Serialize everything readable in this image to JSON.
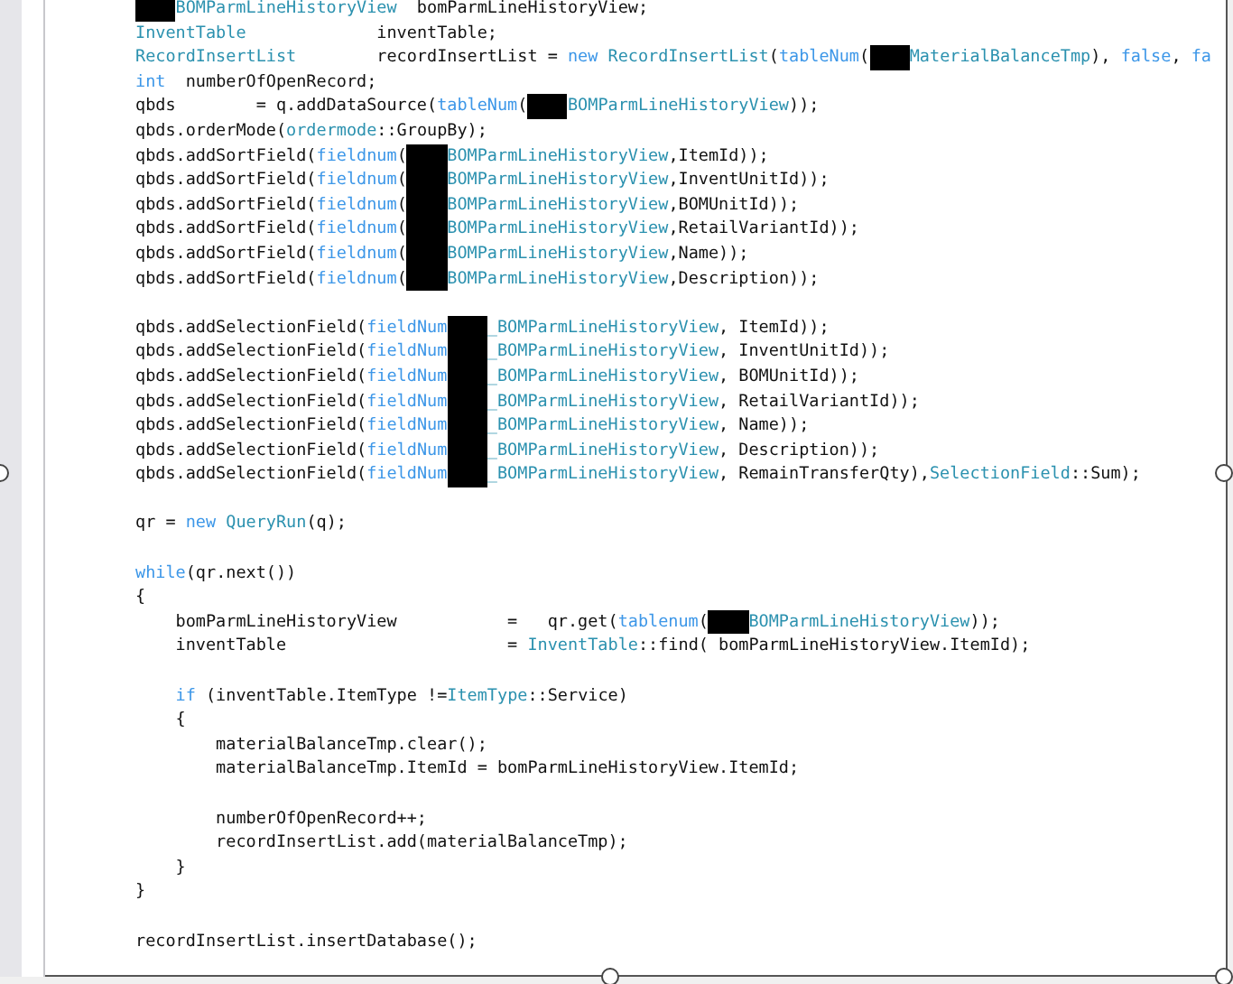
{
  "code_lines": [
    {
      "kind": "code",
      "tokens": [
        {
          "kind": "redacted"
        },
        {
          "kind": "type",
          "text": "BOMParmLineHistoryView"
        },
        {
          "kind": "plain",
          "text": "  bomParmLineHistoryView;"
        }
      ]
    },
    {
      "kind": "code",
      "tokens": [
        {
          "kind": "type",
          "text": "InventTable"
        },
        {
          "kind": "plain",
          "text": "             inventTable;"
        }
      ]
    },
    {
      "kind": "code",
      "tokens": [
        {
          "kind": "type",
          "text": "RecordInsertList"
        },
        {
          "kind": "plain",
          "text": "        recordInsertList = "
        },
        {
          "kind": "keyword",
          "text": "new "
        },
        {
          "kind": "type",
          "text": "RecordInsertList"
        },
        {
          "kind": "plain",
          "text": "("
        },
        {
          "kind": "keyword",
          "text": "tableNum"
        },
        {
          "kind": "plain",
          "text": "("
        },
        {
          "kind": "redacted"
        },
        {
          "kind": "type",
          "text": "MaterialBalanceTmp"
        },
        {
          "kind": "plain",
          "text": "), "
        },
        {
          "kind": "keyword",
          "text": "false"
        },
        {
          "kind": "plain",
          "text": ", "
        },
        {
          "kind": "keyword",
          "text": "fa"
        }
      ]
    },
    {
      "kind": "code",
      "tokens": [
        {
          "kind": "keyword",
          "text": "int"
        },
        {
          "kind": "plain",
          "text": "  numberOfOpenRecord;"
        }
      ]
    },
    {
      "kind": "code",
      "tokens": [
        {
          "kind": "plain",
          "text": "qbds        = q.addDataSource("
        },
        {
          "kind": "keyword",
          "text": "tableNum"
        },
        {
          "kind": "plain",
          "text": "("
        },
        {
          "kind": "redacted"
        },
        {
          "kind": "type",
          "text": "BOMParmLineHistoryView"
        },
        {
          "kind": "plain",
          "text": "));"
        }
      ]
    },
    {
      "kind": "code",
      "tokens": [
        {
          "kind": "plain",
          "text": "qbds.orderMode("
        },
        {
          "kind": "type",
          "text": "ordermode"
        },
        {
          "kind": "plain",
          "text": "::GroupBy);"
        }
      ]
    },
    {
      "kind": "code",
      "tokens": [
        {
          "kind": "plain",
          "text": "qbds.addSortField("
        },
        {
          "kind": "keyword",
          "text": "fieldnum"
        },
        {
          "kind": "plain",
          "text": "("
        },
        {
          "kind": "redacted"
        },
        {
          "kind": "type",
          "text": "BOMParmLineHistoryView"
        },
        {
          "kind": "plain",
          "text": ",ItemId));"
        }
      ]
    },
    {
      "kind": "code",
      "tokens": [
        {
          "kind": "plain",
          "text": "qbds.addSortField("
        },
        {
          "kind": "keyword",
          "text": "fieldnum"
        },
        {
          "kind": "plain",
          "text": "("
        },
        {
          "kind": "redacted"
        },
        {
          "kind": "type",
          "text": "BOMParmLineHistoryView"
        },
        {
          "kind": "plain",
          "text": ",InventUnitId));"
        }
      ]
    },
    {
      "kind": "code",
      "tokens": [
        {
          "kind": "plain",
          "text": "qbds.addSortField("
        },
        {
          "kind": "keyword",
          "text": "fieldnum"
        },
        {
          "kind": "plain",
          "text": "("
        },
        {
          "kind": "redacted"
        },
        {
          "kind": "type",
          "text": "BOMParmLineHistoryView"
        },
        {
          "kind": "plain",
          "text": ",BOMUnitId));"
        }
      ]
    },
    {
      "kind": "code",
      "tokens": [
        {
          "kind": "plain",
          "text": "qbds.addSortField("
        },
        {
          "kind": "keyword",
          "text": "fieldnum"
        },
        {
          "kind": "plain",
          "text": "("
        },
        {
          "kind": "redacted"
        },
        {
          "kind": "type",
          "text": "BOMParmLineHistoryView"
        },
        {
          "kind": "plain",
          "text": ",RetailVariantId));"
        }
      ]
    },
    {
      "kind": "code",
      "tokens": [
        {
          "kind": "plain",
          "text": "qbds.addSortField("
        },
        {
          "kind": "keyword",
          "text": "fieldnum"
        },
        {
          "kind": "plain",
          "text": "("
        },
        {
          "kind": "redacted"
        },
        {
          "kind": "type",
          "text": "BOMParmLineHistoryView"
        },
        {
          "kind": "plain",
          "text": ",Name));"
        }
      ]
    },
    {
      "kind": "code",
      "tokens": [
        {
          "kind": "plain",
          "text": "qbds.addSortField("
        },
        {
          "kind": "keyword",
          "text": "fieldnum"
        },
        {
          "kind": "plain",
          "text": "("
        },
        {
          "kind": "redacted"
        },
        {
          "kind": "type",
          "text": "BOMParmLineHistoryView"
        },
        {
          "kind": "plain",
          "text": ",Description));"
        }
      ]
    },
    {
      "kind": "blank"
    },
    {
      "kind": "code",
      "tokens": [
        {
          "kind": "plain",
          "text": "qbds.addSelectionField("
        },
        {
          "kind": "keyword",
          "text": "fieldNum"
        },
        {
          "kind": "redacted"
        },
        {
          "kind": "type",
          "text": "_BOMParmLineHistoryView"
        },
        {
          "kind": "plain",
          "text": ", ItemId));"
        }
      ]
    },
    {
      "kind": "code",
      "tokens": [
        {
          "kind": "plain",
          "text": "qbds.addSelectionField("
        },
        {
          "kind": "keyword",
          "text": "fieldNum"
        },
        {
          "kind": "redacted"
        },
        {
          "kind": "type",
          "text": "_BOMParmLineHistoryView"
        },
        {
          "kind": "plain",
          "text": ", InventUnitId));"
        }
      ]
    },
    {
      "kind": "code",
      "tokens": [
        {
          "kind": "plain",
          "text": "qbds.addSelectionField("
        },
        {
          "kind": "keyword",
          "text": "fieldNum"
        },
        {
          "kind": "redacted"
        },
        {
          "kind": "type",
          "text": "_BOMParmLineHistoryView"
        },
        {
          "kind": "plain",
          "text": ", BOMUnitId));"
        }
      ]
    },
    {
      "kind": "code",
      "tokens": [
        {
          "kind": "plain",
          "text": "qbds.addSelectionField("
        },
        {
          "kind": "keyword",
          "text": "fieldNum"
        },
        {
          "kind": "redacted"
        },
        {
          "kind": "type",
          "text": "_BOMParmLineHistoryView"
        },
        {
          "kind": "plain",
          "text": ", RetailVariantId));"
        }
      ]
    },
    {
      "kind": "code",
      "tokens": [
        {
          "kind": "plain",
          "text": "qbds.addSelectionField("
        },
        {
          "kind": "keyword",
          "text": "fieldNum"
        },
        {
          "kind": "redacted"
        },
        {
          "kind": "type",
          "text": "_BOMParmLineHistoryView"
        },
        {
          "kind": "plain",
          "text": ", Name));"
        }
      ]
    },
    {
      "kind": "code",
      "tokens": [
        {
          "kind": "plain",
          "text": "qbds.addSelectionField("
        },
        {
          "kind": "keyword",
          "text": "fieldNum"
        },
        {
          "kind": "redacted"
        },
        {
          "kind": "type",
          "text": "_BOMParmLineHistoryView"
        },
        {
          "kind": "plain",
          "text": ", Description));"
        }
      ]
    },
    {
      "kind": "code",
      "tokens": [
        {
          "kind": "plain",
          "text": "qbds.addSelectionField("
        },
        {
          "kind": "keyword",
          "text": "fieldNum"
        },
        {
          "kind": "redacted"
        },
        {
          "kind": "type",
          "text": "_BOMParmLineHistoryView"
        },
        {
          "kind": "plain",
          "text": ", RemainTransferQty),"
        },
        {
          "kind": "type",
          "text": "SelectionField"
        },
        {
          "kind": "plain",
          "text": "::Sum);"
        }
      ]
    },
    {
      "kind": "blank"
    },
    {
      "kind": "code",
      "tokens": [
        {
          "kind": "plain",
          "text": "qr = "
        },
        {
          "kind": "keyword",
          "text": "new "
        },
        {
          "kind": "type",
          "text": "QueryRun"
        },
        {
          "kind": "plain",
          "text": "(q);"
        }
      ]
    },
    {
      "kind": "blank"
    },
    {
      "kind": "code",
      "tokens": [
        {
          "kind": "keyword",
          "text": "while"
        },
        {
          "kind": "plain",
          "text": "(qr.next())"
        }
      ]
    },
    {
      "kind": "code",
      "tokens": [
        {
          "kind": "plain",
          "text": "{"
        }
      ]
    },
    {
      "kind": "code",
      "tokens": [
        {
          "kind": "plain",
          "text": "    bomParmLineHistoryView           =   qr.get("
        },
        {
          "kind": "keyword",
          "text": "tablenum"
        },
        {
          "kind": "plain",
          "text": "("
        },
        {
          "kind": "redacted"
        },
        {
          "kind": "type",
          "text": "BOMParmLineHistoryView"
        },
        {
          "kind": "plain",
          "text": "));"
        }
      ]
    },
    {
      "kind": "code",
      "tokens": [
        {
          "kind": "plain",
          "text": "    inventTable                      = "
        },
        {
          "kind": "type",
          "text": "InventTable"
        },
        {
          "kind": "plain",
          "text": "::find( bomParmLineHistoryView.ItemId);"
        }
      ]
    },
    {
      "kind": "blank"
    },
    {
      "kind": "code",
      "tokens": [
        {
          "kind": "keyword",
          "text": "    if"
        },
        {
          "kind": "plain",
          "text": " (inventTable.ItemType !="
        },
        {
          "kind": "type",
          "text": "ItemType"
        },
        {
          "kind": "plain",
          "text": "::Service)"
        }
      ]
    },
    {
      "kind": "code",
      "tokens": [
        {
          "kind": "plain",
          "text": "    {"
        }
      ]
    },
    {
      "kind": "code",
      "tokens": [
        {
          "kind": "plain",
          "text": "        materialBalanceTmp.clear();"
        }
      ]
    },
    {
      "kind": "code",
      "tokens": [
        {
          "kind": "plain",
          "text": "        materialBalanceTmp.ItemId = bomParmLineHistoryView.ItemId;"
        }
      ]
    },
    {
      "kind": "blank"
    },
    {
      "kind": "code",
      "tokens": [
        {
          "kind": "plain",
          "text": "        numberOfOpenRecord++;"
        }
      ]
    },
    {
      "kind": "code",
      "tokens": [
        {
          "kind": "plain",
          "text": "        recordInsertList.add(materialBalanceTmp);"
        }
      ]
    },
    {
      "kind": "code",
      "tokens": [
        {
          "kind": "plain",
          "text": "    }"
        }
      ]
    },
    {
      "kind": "code",
      "tokens": [
        {
          "kind": "plain",
          "text": "}"
        }
      ]
    },
    {
      "kind": "blank"
    },
    {
      "kind": "code",
      "tokens": [
        {
          "kind": "plain",
          "text": "recordInsertList.insertDatabase();"
        }
      ]
    }
  ]
}
